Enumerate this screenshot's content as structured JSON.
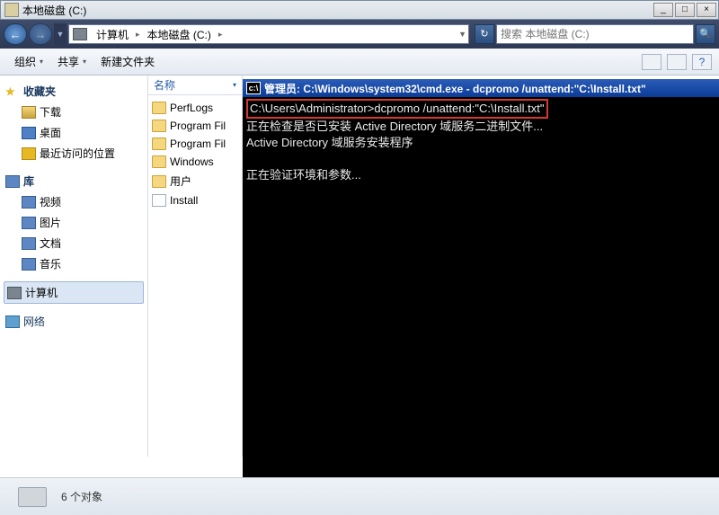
{
  "window": {
    "title": "本地磁盘 (C:)",
    "min": "_",
    "max": "□",
    "close": "×"
  },
  "nav": {
    "back": "←",
    "fwd": "→",
    "breadcrumb": {
      "root": "计算机",
      "sep": "▸",
      "current": "本地磁盘 (C:)"
    },
    "refresh": "↻",
    "search_placeholder": "搜索 本地磁盘 (C:)",
    "go": "🔍"
  },
  "toolbar": {
    "organize": "组织",
    "share": "共享",
    "newfolder": "新建文件夹",
    "dd": "▾"
  },
  "sidebar": {
    "fav": "收藏夹",
    "fav_items": [
      "下载",
      "桌面",
      "最近访问的位置"
    ],
    "lib": "库",
    "lib_items": [
      "视频",
      "图片",
      "文档",
      "音乐"
    ],
    "computer": "计算机",
    "network": "网络"
  },
  "filecol": {
    "header": "名称",
    "items": [
      "PerfLogs",
      "Program Fil",
      "Program Fil",
      "Windows",
      "用户",
      "Install"
    ]
  },
  "status": {
    "text": "6 个对象"
  },
  "cmd": {
    "title": "管理员: C:\\Windows\\system32\\cmd.exe - dcpromo  /unattend:\"C:\\Install.txt\"",
    "prompt_prefix": "C:\\Users\\Administrator>",
    "prompt_cmd": "dcpromo /unattend:\"C:\\Install.txt\"",
    "line2": "正在检查是否已安装 Active Directory 域服务二进制文件...",
    "line3": "Active Directory 域服务安装程序",
    "line4": "正在验证环境和参数..."
  }
}
